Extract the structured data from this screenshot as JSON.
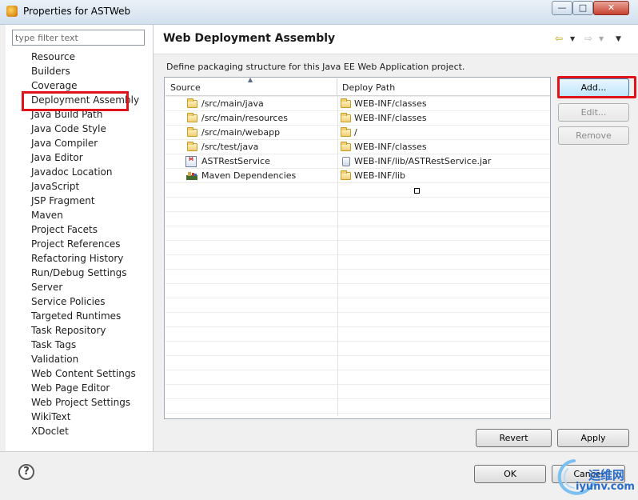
{
  "window": {
    "title": "Properties for ASTWeb",
    "controls": {
      "minimize": "—",
      "maximize": "□",
      "close": "✕"
    }
  },
  "filter": {
    "placeholder": "type filter text"
  },
  "sidebar": {
    "items": [
      "Resource",
      "Builders",
      "Coverage",
      "Deployment Assembly",
      "Java Build Path",
      "Java Code Style",
      "Java Compiler",
      "Java Editor",
      "Javadoc Location",
      "JavaScript",
      "JSP Fragment",
      "Maven",
      "Project Facets",
      "Project References",
      "Refactoring History",
      "Run/Debug Settings",
      "Server",
      "Service Policies",
      "Targeted Runtimes",
      "Task Repository",
      "Task Tags",
      "Validation",
      "Web Content Settings",
      "Web Page Editor",
      "Web Project Settings",
      "WikiText",
      "XDoclet"
    ],
    "selected": "Deployment Assembly"
  },
  "page": {
    "title": "Web Deployment Assembly",
    "description": "Define packaging structure for this Java EE Web Application project."
  },
  "table": {
    "headers": {
      "source": "Source",
      "deploy_path": "Deploy Path"
    },
    "rows": [
      {
        "source": "/src/main/java",
        "deploy": "WEB-INF/classes",
        "source_icon": "folder-icon",
        "deploy_icon": "folder-icon"
      },
      {
        "source": "/src/main/resources",
        "deploy": "WEB-INF/classes",
        "source_icon": "folder-icon",
        "deploy_icon": "folder-icon"
      },
      {
        "source": "/src/main/webapp",
        "deploy": "/",
        "source_icon": "folder-icon",
        "deploy_icon": "folder-icon"
      },
      {
        "source": "/src/test/java",
        "deploy": "WEB-INF/classes",
        "source_icon": "folder-icon",
        "deploy_icon": "folder-icon"
      },
      {
        "source": "ASTRestService",
        "deploy": "WEB-INF/lib/ASTRestService.jar",
        "source_icon": "project-icon",
        "deploy_icon": "jar-icon"
      },
      {
        "source": "Maven Dependencies",
        "deploy": "WEB-INF/lib",
        "source_icon": "maven-library-icon",
        "deploy_icon": "folder-icon"
      }
    ]
  },
  "buttons": {
    "add": "Add...",
    "edit": "Edit...",
    "remove": "Remove",
    "revert": "Revert",
    "apply": "Apply",
    "ok": "OK",
    "cancel": "Cancel"
  },
  "watermark": {
    "cn": "运维网",
    "url": "iyunv.com"
  },
  "colors": {
    "highlight": "#e0131b",
    "accent": "#3c7fb1"
  }
}
